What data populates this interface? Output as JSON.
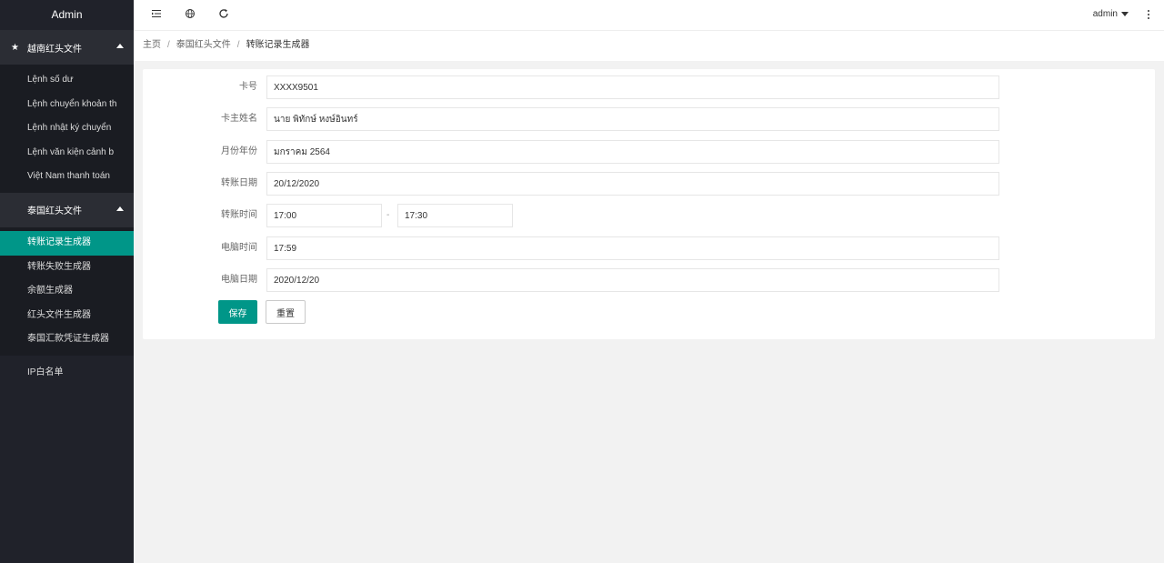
{
  "sidebar": {
    "title": "Admin",
    "groups": [
      {
        "label": "越南红头文件",
        "items": [
          {
            "label": "Lệnh số dư"
          },
          {
            "label": "Lệnh chuyển khoản th"
          },
          {
            "label": "Lệnh nhật ký chuyển"
          },
          {
            "label": "Lệnh văn kiện cảnh b"
          },
          {
            "label": "Việt Nam thanh toán"
          }
        ]
      },
      {
        "label": "泰国红头文件",
        "items": [
          {
            "label": "转账记录生成器"
          },
          {
            "label": "转账失败生成器"
          },
          {
            "label": "余额生成器"
          },
          {
            "label": "红头文件生成器"
          },
          {
            "label": "泰国汇款凭证生成器"
          }
        ]
      }
    ],
    "ip_item": "IP白名单"
  },
  "header": {
    "user": "admin"
  },
  "breadcrumb": {
    "home": "主页",
    "parent": "泰国红头文件",
    "current": "转账记录生成器"
  },
  "form": {
    "card_no": {
      "label": "卡号",
      "value": "XXXX9501"
    },
    "holder": {
      "label": "卡主姓名",
      "value": "นาย พิทักษ์ หงษ์อินทร์"
    },
    "month_year": {
      "label": "月份年份",
      "value": "มกราคม 2564"
    },
    "transfer_date": {
      "label": "转账日期",
      "value": "20/12/2020"
    },
    "transfer_time": {
      "label": "转账时间",
      "start": "17:00",
      "sep": "-",
      "end": "17:30"
    },
    "pc_time": {
      "label": "电脑时间",
      "value": "17:59"
    },
    "pc_date": {
      "label": "电脑日期",
      "value": "2020/12/20"
    },
    "save_label": "保存",
    "reset_label": "重置"
  }
}
